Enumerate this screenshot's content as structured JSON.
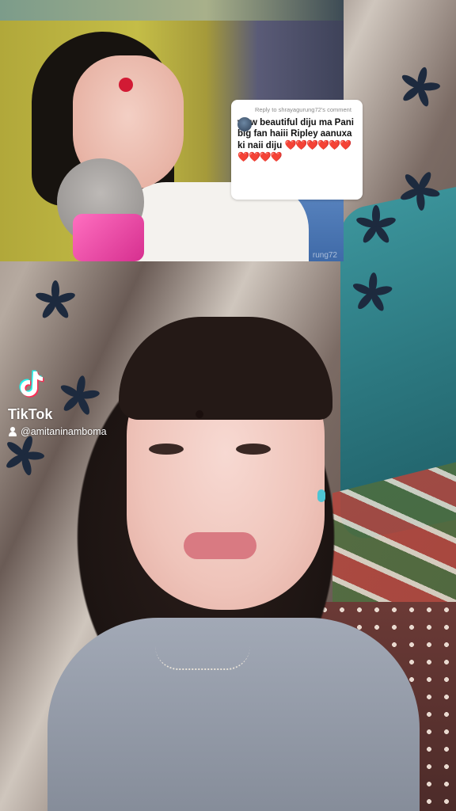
{
  "reply_comment": {
    "reply_to": "Reply to shrayagurung72's comment",
    "text": "wow beautiful diju ma Pani big fan haiii Ripley aanuxa ki naii diju",
    "hearts_line1": "❤️❤️❤️❤️❤️❤️",
    "hearts_line2": "❤️❤️❤️❤️"
  },
  "reply_video": {
    "watermark": "rung72"
  },
  "watermark": {
    "brand": "TikTok",
    "username": "@amitaninamboma"
  },
  "icons": [
    "tiktok-logo-icon",
    "user-icon",
    "commenter-avatar"
  ]
}
